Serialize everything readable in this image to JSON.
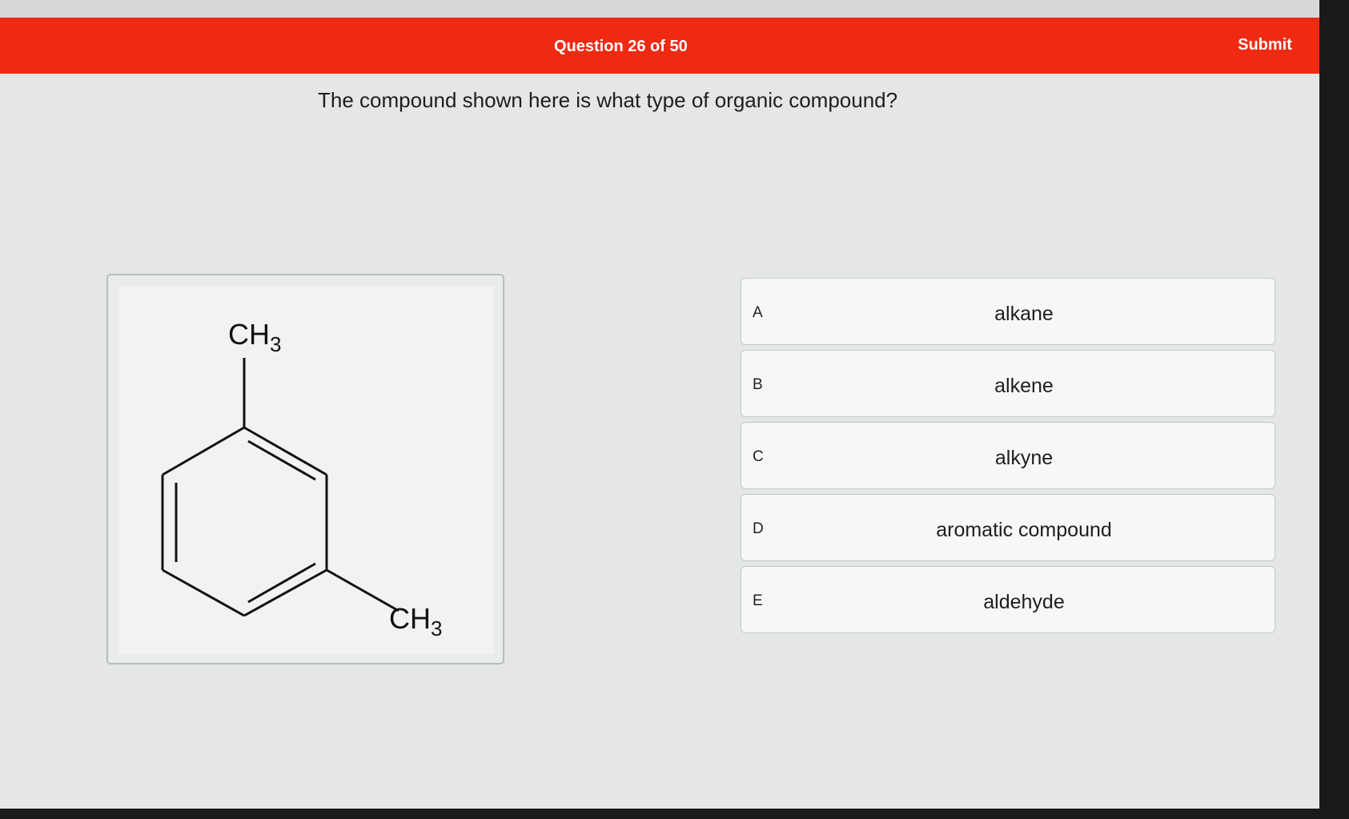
{
  "header": {
    "progress": "Question 26 of 50",
    "submit_label": "Submit"
  },
  "question": {
    "text": "The compound shown here is what type of organic compound?"
  },
  "figure": {
    "top_group": "CH3",
    "bottom_group": "CH3"
  },
  "options": [
    {
      "letter": "A",
      "text": "alkane"
    },
    {
      "letter": "B",
      "text": "alkene"
    },
    {
      "letter": "C",
      "text": "alkyne"
    },
    {
      "letter": "D",
      "text": "aromatic compound"
    },
    {
      "letter": "E",
      "text": "aldehyde"
    }
  ],
  "colors": {
    "header": "#f02a12",
    "background": "#e4e6e7"
  }
}
